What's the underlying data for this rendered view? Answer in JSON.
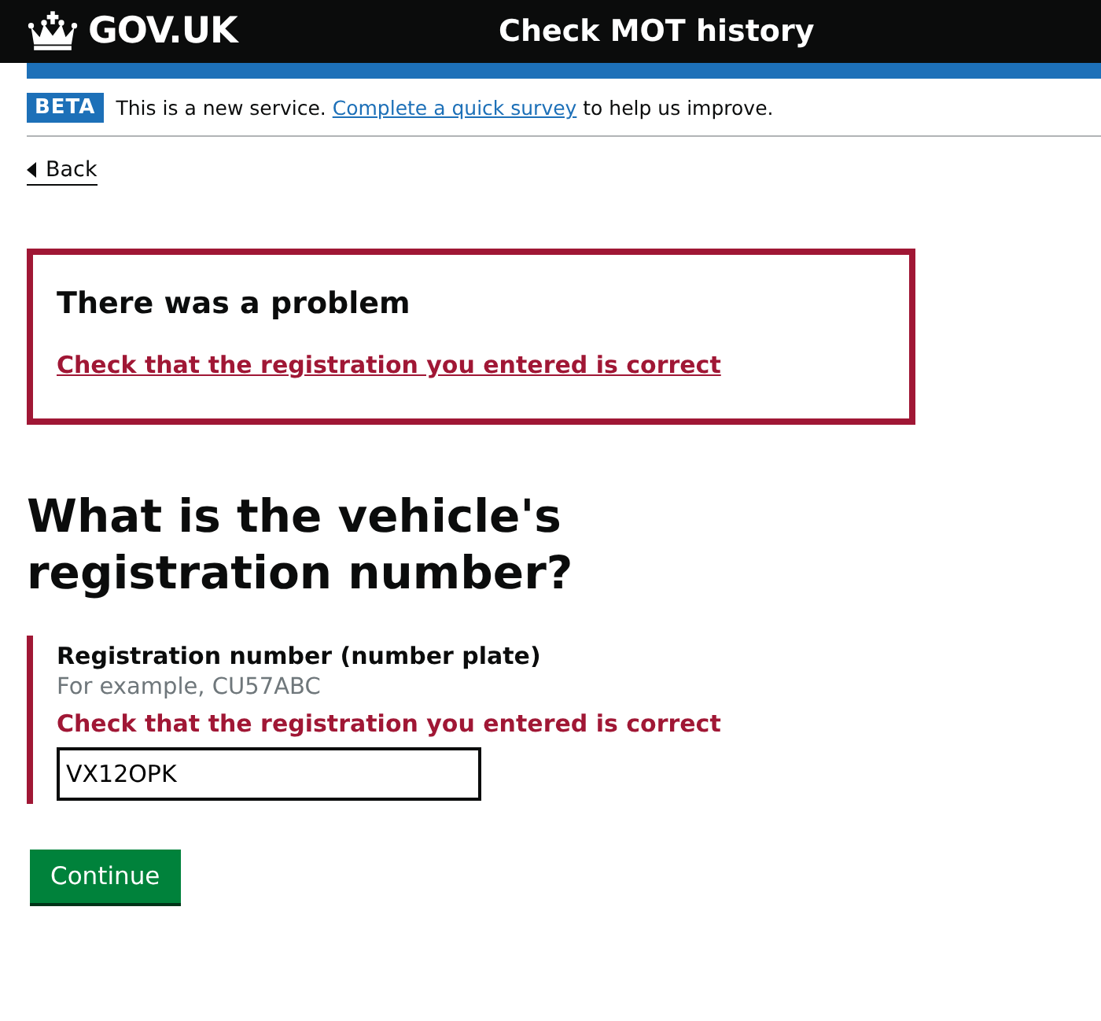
{
  "header": {
    "logo": "GOV.UK",
    "service_name": "Check MOT history"
  },
  "phase_banner": {
    "tag": "BETA",
    "text_before": "This is a new service.",
    "link": "Complete a quick survey",
    "text_after": "to help us improve."
  },
  "back_link": "Back",
  "error_summary": {
    "title": "There was a problem",
    "errors": [
      "Check that the registration you entered is correct"
    ]
  },
  "heading": "What is the vehicle's registration number?",
  "field": {
    "label": "Registration number (number plate)",
    "hint": "For example, CU57ABC",
    "error": "Check that the registration you entered is correct",
    "value": "VX12OPK",
    "has_error": true
  },
  "button": "Continue"
}
